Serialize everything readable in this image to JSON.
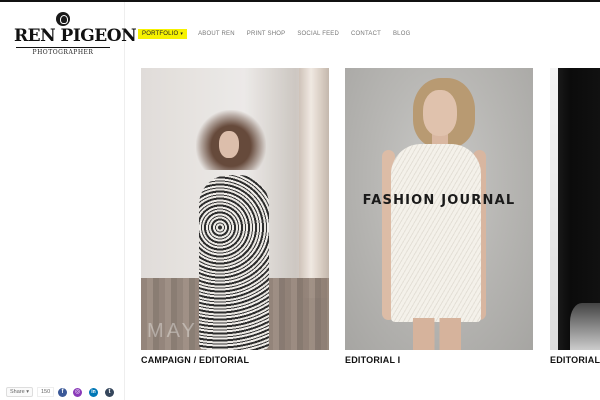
{
  "site": {
    "name": "REN PIGEON",
    "tagline": "PHOTOGRAPHER"
  },
  "nav": {
    "items": [
      {
        "label": "PORTFOLIO",
        "active": true
      },
      {
        "label": "ABOUT REN",
        "active": false
      },
      {
        "label": "PRINT SHOP",
        "active": false
      },
      {
        "label": "SOCIAL FEED",
        "active": false
      },
      {
        "label": "CONTACT",
        "active": false
      },
      {
        "label": "BLOG",
        "active": false
      }
    ],
    "active_color": "#f6f200"
  },
  "share": {
    "button_label": "Share",
    "count": "150",
    "networks": [
      {
        "name": "facebook-icon",
        "glyph": "f",
        "color": "#3b5998"
      },
      {
        "name": "instagram-icon",
        "glyph": "◎",
        "color": "#8a3ab9"
      },
      {
        "name": "linkedin-icon",
        "glyph": "in",
        "color": "#0077b5"
      },
      {
        "name": "tumblr-icon",
        "glyph": "t",
        "color": "#35465c"
      }
    ]
  },
  "gallery": [
    {
      "caption": "CAMPAIGN / EDITORIAL",
      "watermark": "MAY"
    },
    {
      "caption": "EDITORIAL I",
      "overlay_title": "FASHION JOURNAL"
    },
    {
      "caption": "EDITORIAL I"
    }
  ]
}
